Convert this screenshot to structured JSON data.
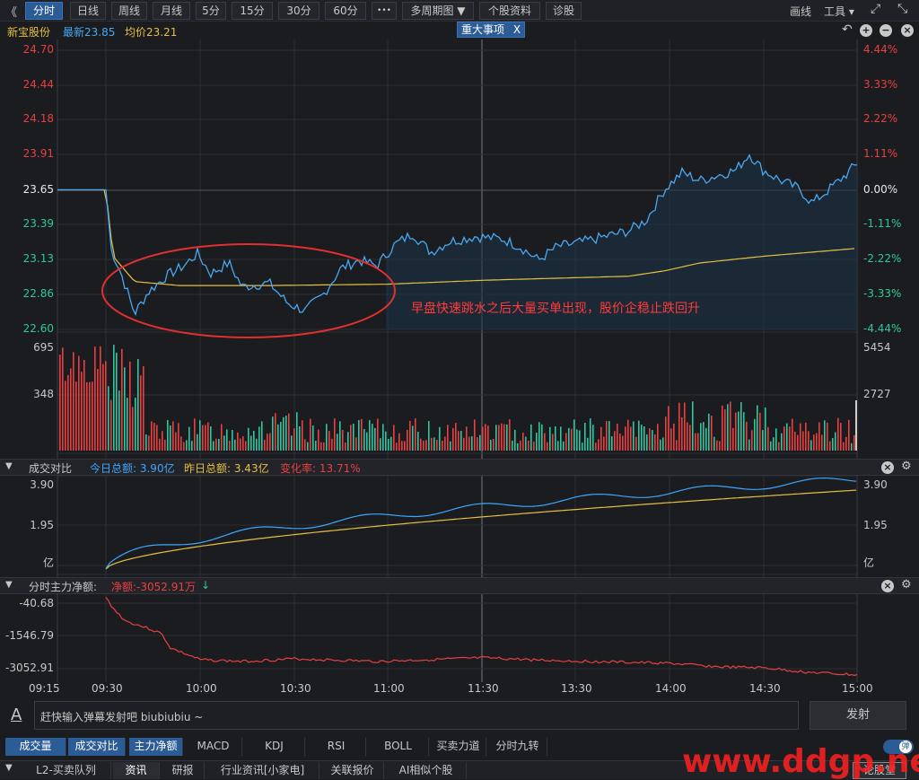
{
  "toolbar": {
    "back": "《",
    "periods": [
      "分时",
      "日线",
      "周线",
      "月线",
      "5分",
      "15分",
      "30分",
      "60分"
    ],
    "more": "•••",
    "multi": "多周期图 ▼",
    "profile": "个股资料",
    "diag": "诊股",
    "draw": "画线",
    "tools": "工具 ▾"
  },
  "info": {
    "name": "新宝股份",
    "latest": "最新23.85",
    "avg": "均价23.21",
    "event": "重大事项",
    "event_close": "X"
  },
  "price_axis": {
    "left": [
      "24.70",
      "24.44",
      "24.18",
      "23.91",
      "23.65",
      "23.39",
      "23.13",
      "22.86",
      "22.60"
    ],
    "right": [
      "4.44%",
      "3.33%",
      "2.22%",
      "1.11%",
      "0.00%",
      "-1.11%",
      "-2.22%",
      "-3.33%",
      "-4.44%"
    ]
  },
  "annotation": "早盘快速跳水之后大量买单出现，股价企稳止跌回升",
  "volume_axis": {
    "left": [
      "695",
      "348"
    ],
    "right": [
      "5454",
      "2727"
    ]
  },
  "panel1": {
    "title": "成交对比",
    "today": "今日总额: 3.90亿",
    "yesterday": "昨日总额: 3.43亿",
    "change": "变化率: 13.71%",
    "left": [
      "3.90",
      "1.95",
      "亿"
    ],
    "right": [
      "3.90",
      "1.95",
      "亿"
    ]
  },
  "panel2": {
    "title": "分时主力净额:",
    "net": "净额:-3052.91万",
    "left": [
      "-40.68",
      "-1546.79",
      "-3052.91"
    ]
  },
  "time_axis": [
    "09:15",
    "09:30",
    "10:00",
    "10:30",
    "11:00",
    "11:30",
    "13:30",
    "14:00",
    "14:30",
    "15:00"
  ],
  "danmu": {
    "placeholder": "赶快输入弹幕发射吧 biubiubiu ~",
    "send": "发射",
    "toggle": "弹"
  },
  "indicator_tabs": [
    "成交量",
    "成交对比",
    "主力净额",
    "MACD",
    "KDJ",
    "RSI",
    "BOLL",
    "买卖力道",
    "分时九转"
  ],
  "bottom_tabs": [
    "L2-买卖队列",
    "资讯",
    "研报",
    "行业资讯[小家电]",
    "关联报价",
    "AI相似个股"
  ],
  "bottom_right": "论股堂",
  "watermark": "www.ddgp.net",
  "colors": {
    "up": "#e84040",
    "down": "#2fc6a0",
    "price": "#4aa8f0",
    "avg": "#e6c040",
    "blue": "#3ea6ff",
    "yellow": "#e6c040"
  },
  "chart_data": {
    "type": "line",
    "title": "",
    "x": [
      "09:15",
      "09:30",
      "10:00",
      "10:30",
      "11:00",
      "11:30",
      "13:30",
      "14:00",
      "14:30",
      "15:00"
    ],
    "ylim": [
      22.6,
      24.7
    ],
    "prev_close": 23.65,
    "series": [
      {
        "name": "最新",
        "values": [
          23.65,
          23.65,
          22.98,
          23.08,
          22.92,
          23.17,
          23.35,
          23.22,
          23.58,
          23.76,
          23.85
        ]
      },
      {
        "name": "均价",
        "values": [
          23.65,
          23.65,
          22.99,
          22.92,
          22.93,
          22.96,
          23.0,
          23.05,
          23.16,
          23.19,
          23.21
        ]
      }
    ]
  }
}
